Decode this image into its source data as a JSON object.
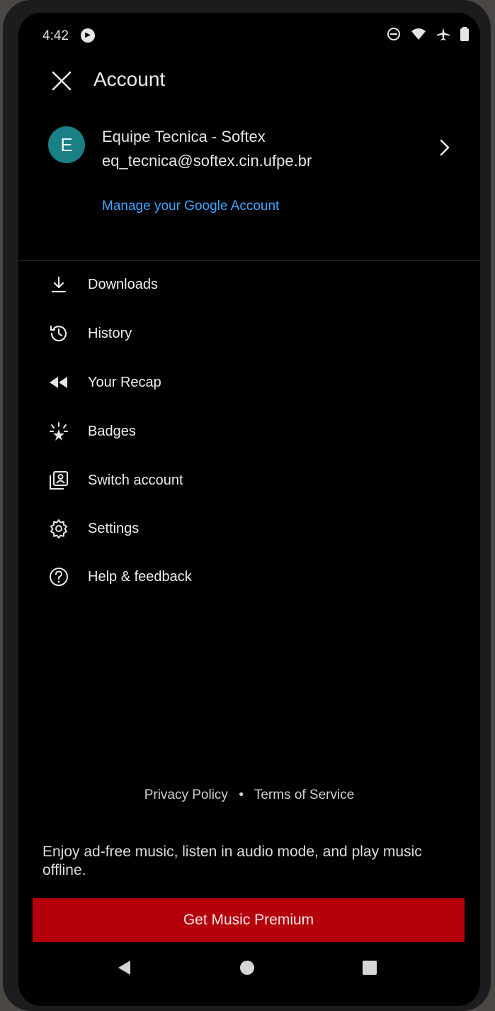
{
  "status_bar": {
    "time": "4:42",
    "icons": [
      "media-playing-icon",
      "do-not-disturb-icon",
      "wifi-icon",
      "airplane-mode-icon",
      "battery-icon"
    ]
  },
  "header": {
    "close_icon": "close-icon",
    "title": "Account"
  },
  "account": {
    "avatar_letter": "E",
    "avatar_color": "#1b7f86",
    "name": "Equipe Tecnica - Softex",
    "email": "eq_tecnica@softex.cin.ufpe.br",
    "manage_link": "Manage your Google Account",
    "link_color": "#3ea6ff"
  },
  "menu": [
    {
      "label": "Downloads",
      "icon": "download-icon"
    },
    {
      "label": "History",
      "icon": "history-icon"
    },
    {
      "label": "Your Recap",
      "icon": "rewind-icon"
    },
    {
      "label": "Badges",
      "icon": "badges-icon"
    },
    {
      "label": "Switch account",
      "icon": "switch-account-icon"
    },
    {
      "label": "Settings",
      "icon": "gear-icon"
    },
    {
      "label": "Help & feedback",
      "icon": "help-icon"
    }
  ],
  "footer": {
    "privacy": "Privacy Policy",
    "separator": "•",
    "terms": "Terms of Service"
  },
  "promo": {
    "text": "Enjoy ad-free music, listen in audio mode, and play music offline.",
    "button_label": "Get Music Premium",
    "button_color": "#b3000b"
  },
  "nav_bar": {
    "back_icon": "back-icon",
    "home_icon": "home-icon",
    "recents_icon": "recents-icon"
  }
}
